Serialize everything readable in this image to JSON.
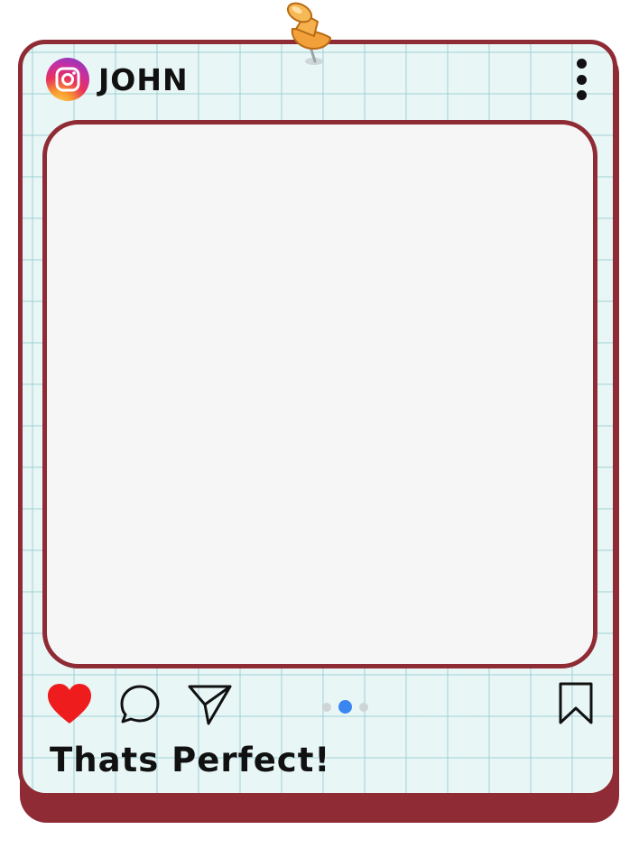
{
  "post": {
    "username": "JOHN",
    "caption": "Thats Perfect!"
  },
  "icons": {
    "platform": "instagram-icon",
    "menu": "more-vertical-icon",
    "like": "heart-icon",
    "comment": "comment-icon",
    "share": "send-icon",
    "save": "bookmark-icon",
    "decoration": "pushpin-icon"
  },
  "carousel": {
    "total": 3,
    "active_index": 1
  },
  "colors": {
    "frame": "#8f2b34",
    "grid_background": "#e9f6f6",
    "like": "#ee1c1c",
    "active_dot": "#3a86f0"
  }
}
